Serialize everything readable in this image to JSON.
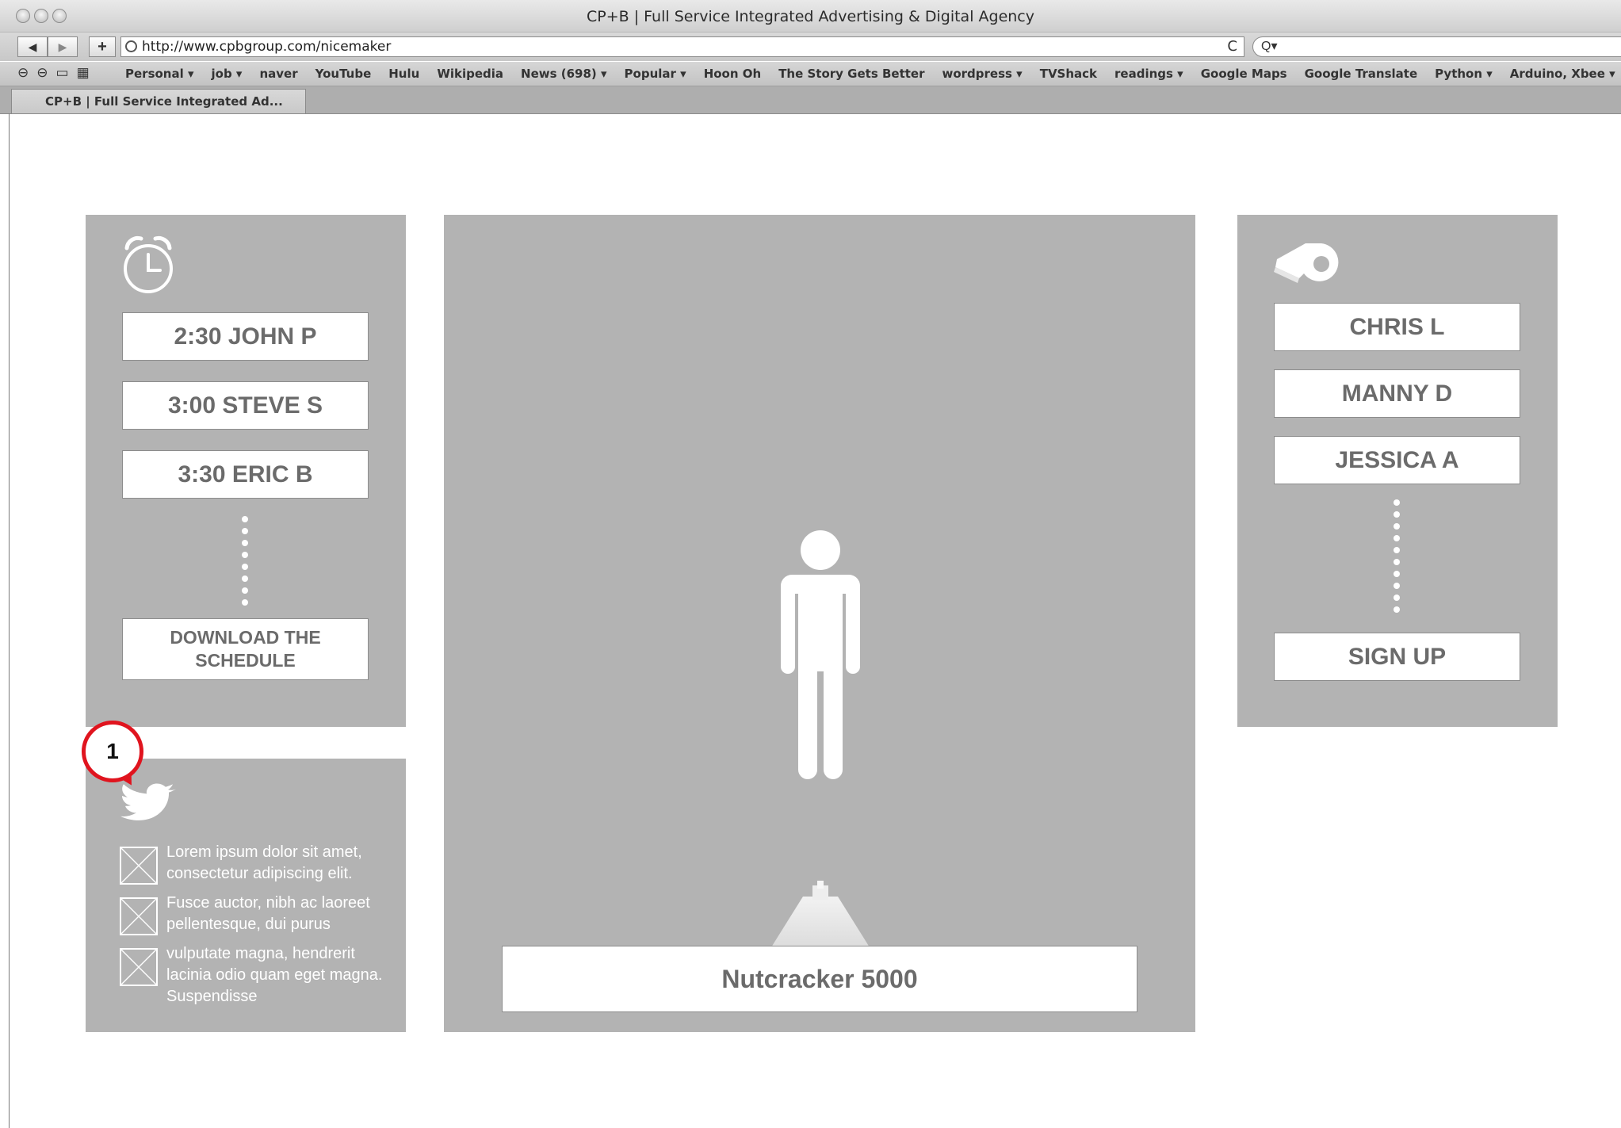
{
  "window": {
    "title": "CP+B | Full Service Integrated Advertising & Digital Agency"
  },
  "toolbar": {
    "back": "◀",
    "forward": "▶",
    "add": "+",
    "url": "http://www.cpbgroup.com/nicemaker",
    "reload": "C",
    "search_placeholder": "Q▾"
  },
  "bookmarks": [
    "Personal ▾",
    "job ▾",
    "naver",
    "YouTube",
    "Hulu",
    "Wikipedia",
    "News (698) ▾",
    "Popular ▾",
    "Hoon Oh",
    "The Story Gets Better",
    "wordpress ▾",
    "TVShack",
    "readings ▾",
    "Google Maps",
    "Google Translate",
    "Python ▾",
    "Arduino, Xbee ▾"
  ],
  "tab": {
    "label": "CP+B | Full Service Integrated Ad..."
  },
  "schedule": {
    "items": [
      "2:30 JOHN P",
      "3:00 STEVE S",
      "3:30 ERIC B"
    ],
    "download_label": "DOWNLOAD THE SCHEDULE"
  },
  "twitter": {
    "badge": "1",
    "tweets": [
      "Lorem ipsum dolor sit amet, consectetur adipiscing elit.",
      "Fusce auctor, nibh ac laoreet pellentesque, dui purus",
      "vulputate magna, hendrerit lacinia odio quam eget magna. Suspendisse"
    ]
  },
  "stage": {
    "caption": "Nutcracker 5000"
  },
  "coaches": {
    "items": [
      "CHRIS L",
      "MANNY D",
      "JESSICA A"
    ],
    "signup_label": "SIGN UP"
  }
}
